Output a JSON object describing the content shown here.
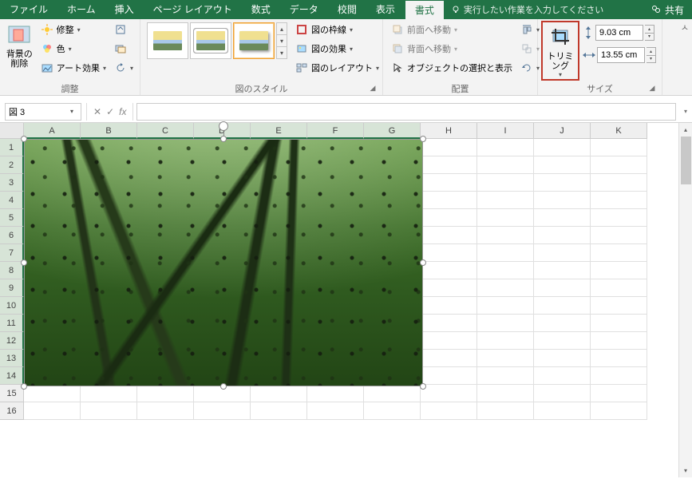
{
  "tabs": {
    "file": "ファイル",
    "home": "ホーム",
    "insert": "挿入",
    "layout": "ページ レイアウト",
    "formulas": "数式",
    "data": "データ",
    "review": "校閲",
    "view": "表示",
    "format": "書式",
    "tellme": "実行したい作業を入力してください",
    "share": "共有"
  },
  "ribbon": {
    "adjust": {
      "remove_bg": "背景の\n削除",
      "corrections": "修整",
      "color": "色",
      "artistic": "アート効果",
      "group": "調整"
    },
    "styles": {
      "border": "図の枠線",
      "effects": "図の効果",
      "layout": "図のレイアウト",
      "group": "図のスタイル"
    },
    "arrange": {
      "bring_fwd": "前面へ移動",
      "send_back": "背面へ移動",
      "selection": "オブジェクトの選択と表示",
      "group": "配置"
    },
    "size": {
      "crop": "トリミング",
      "height": "9.03 cm",
      "width": "13.55 cm",
      "group": "サイズ"
    }
  },
  "formula_bar": {
    "namebox": "図 3"
  },
  "columns": [
    "A",
    "B",
    "C",
    "D",
    "E",
    "F",
    "G",
    "H",
    "I",
    "J",
    "K"
  ],
  "rows": [
    "1",
    "2",
    "3",
    "4",
    "5",
    "6",
    "7",
    "8",
    "9",
    "10",
    "11",
    "12",
    "13",
    "14",
    "15",
    "16"
  ]
}
